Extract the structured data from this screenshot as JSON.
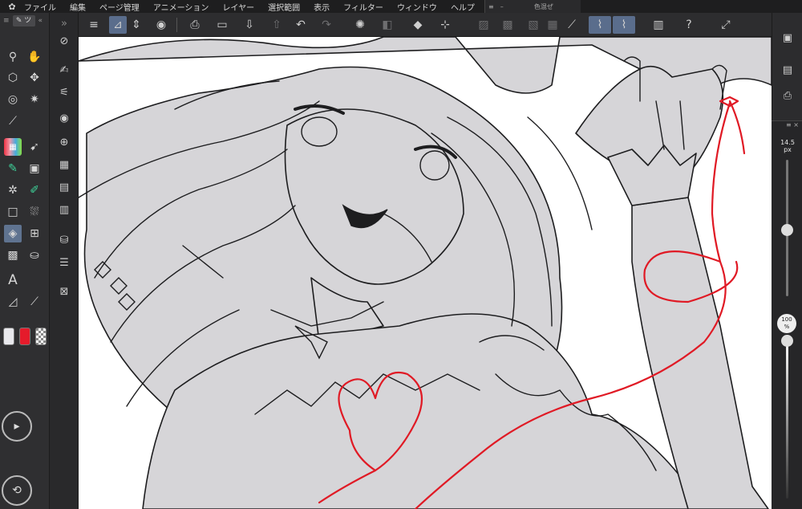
{
  "menu": {
    "items": [
      "ファイル",
      "編集",
      "ページ管理",
      "アニメーション",
      "レイヤー",
      "選択範囲",
      "表示",
      "フィルター",
      "ウィンドウ",
      "ヘルプ"
    ]
  },
  "float_panel": {
    "title": "色混ぜ"
  },
  "size_panel": {
    "brush_size": "14.5",
    "brush_unit": "px",
    "opacity": "100",
    "opacity_unit": "%"
  },
  "colors": {
    "main": "#e8e8ec",
    "sub": "#e51b2b",
    "accent": "#5a6d8c",
    "thread": "#e01a25"
  },
  "icons": {
    "toolbar": [
      "menu-icon",
      "new-canvas-icon",
      "expand-icon",
      "sync-icon",
      "export-icon",
      "folder-icon",
      "save-icon",
      "upload-icon",
      "undo-icon",
      "redo-icon",
      "loading-icon",
      "layer-icon",
      "fill-icon",
      "transform-icon",
      "clear-icon",
      "cut-icon",
      "hatch-icon",
      "ruler-icon",
      "pen-ruler-icon",
      "pen-ruler-active-icon",
      "save-canvas-icon",
      "help-icon",
      "resize-icon"
    ],
    "tools": [
      "zoom-icon",
      "hand-icon",
      "operation-icon",
      "move-icon",
      "lasso-icon",
      "magic-wand-icon",
      "eyedropper-icon",
      "pen-icon",
      "pencil-icon",
      "brush-icon",
      "airbrush-icon",
      "decoration-icon",
      "eraser-icon",
      "fill-icon",
      "gradient-icon",
      "figure-icon",
      "text-icon",
      "balloon-icon",
      "ruler-icon",
      "line-correct-icon"
    ]
  }
}
